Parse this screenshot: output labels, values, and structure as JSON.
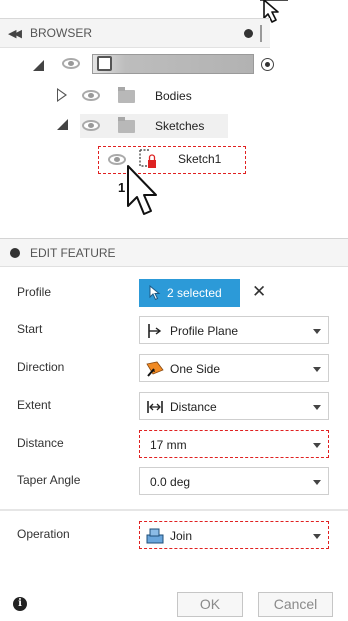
{
  "browser": {
    "title": "BROWSER",
    "nodes": {
      "bodies": "Bodies",
      "sketches": "Sketches",
      "sketch1": "Sketch1"
    },
    "step_label": "1"
  },
  "edit_feature": {
    "title": "EDIT FEATURE",
    "profile": {
      "label": "Profile",
      "value": "2 selected"
    },
    "start": {
      "label": "Start",
      "value": "Profile Plane"
    },
    "direction": {
      "label": "Direction",
      "value": "One Side"
    },
    "extent": {
      "label": "Extent",
      "value": "Distance"
    },
    "distance": {
      "label": "Distance",
      "value": "17 mm"
    },
    "taper_angle": {
      "label": "Taper Angle",
      "value": "0.0 deg"
    },
    "operation": {
      "label": "Operation",
      "value": "Join"
    },
    "ok_label": "OK",
    "cancel_label": "Cancel"
  },
  "colors": {
    "accent": "#2c9ad8",
    "highlight_dash": "#e02020"
  },
  "icons": [
    "cursor-icon",
    "eye-icon",
    "folder-icon",
    "component-icon",
    "sketch-icon",
    "profile-plane-icon",
    "one-side-icon",
    "distance-icon",
    "join-icon",
    "info-icon",
    "close-icon"
  ]
}
